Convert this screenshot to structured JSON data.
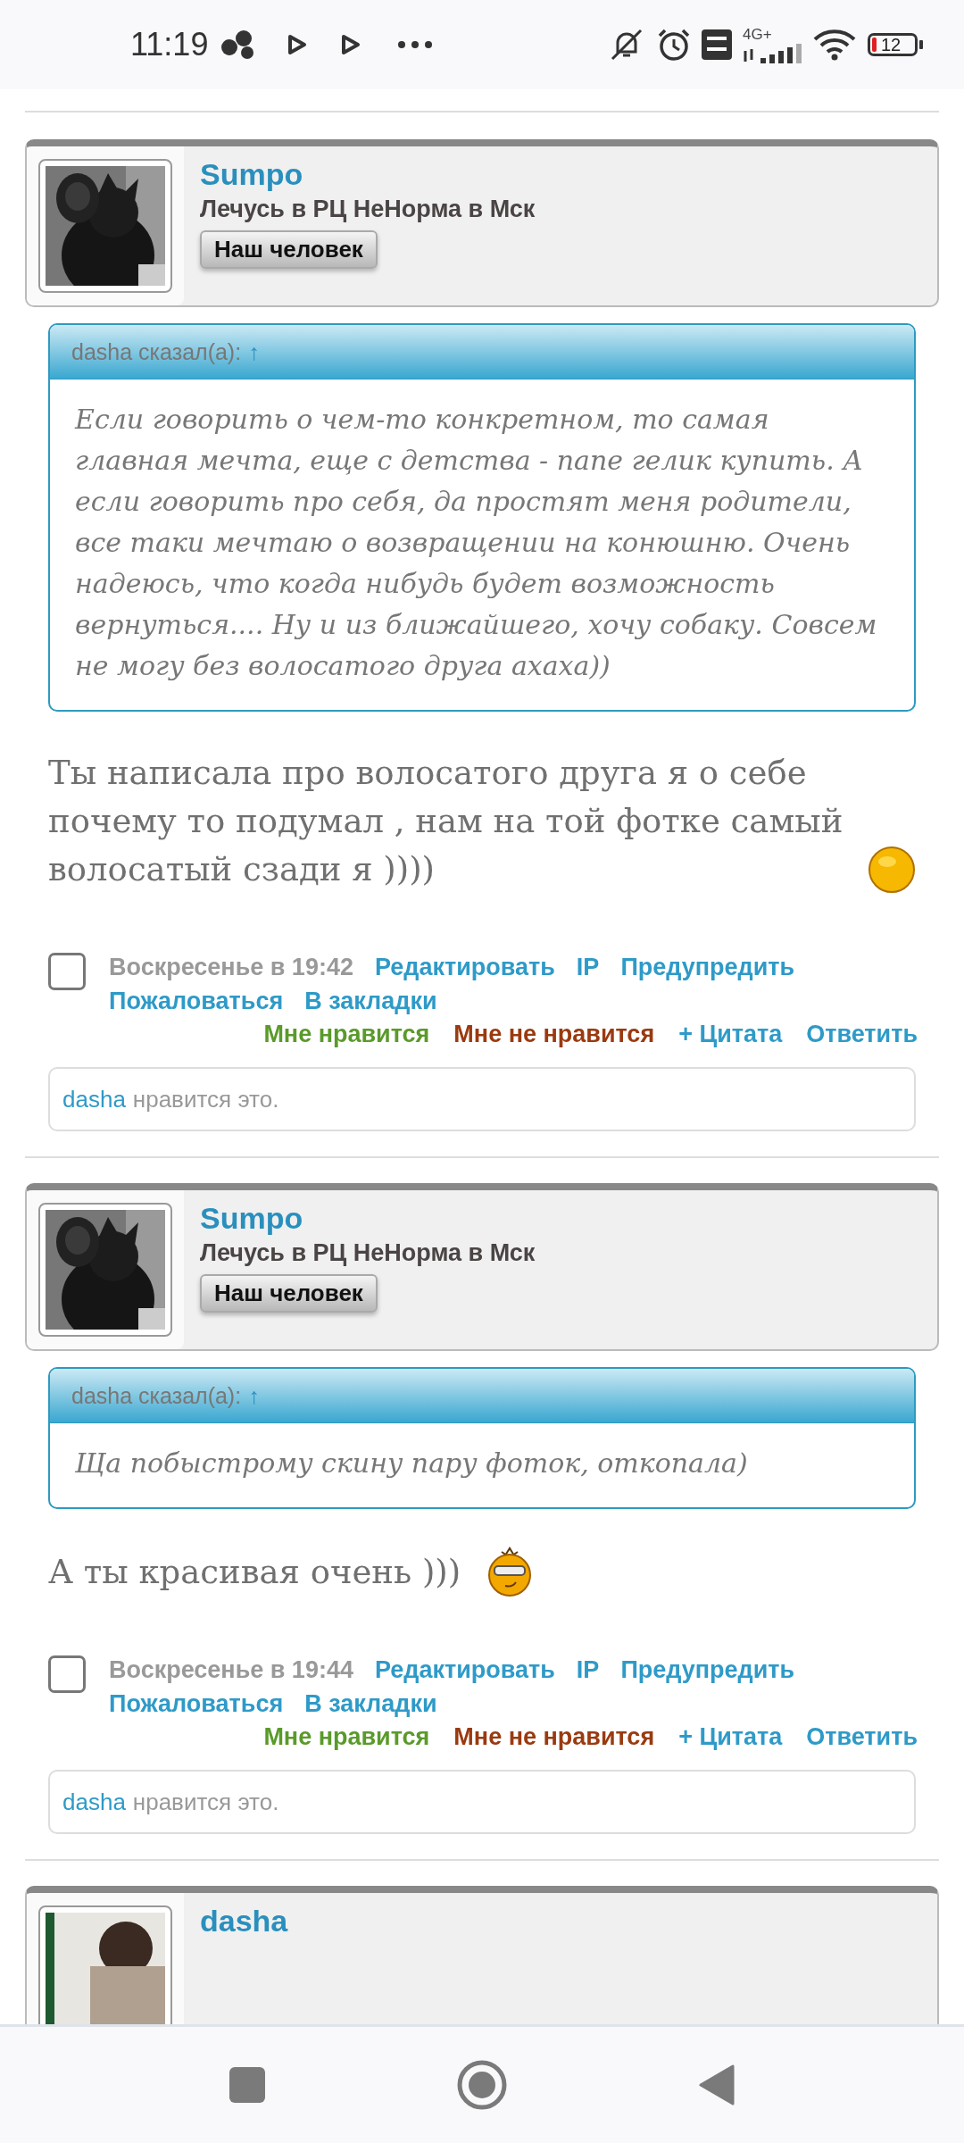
{
  "status_bar": {
    "time": "11:19",
    "network": "4G+",
    "battery": "12"
  },
  "posts": [
    {
      "author": "Sumpo",
      "avatar": {
        "kind": "picture"
      },
      "status": "Лечусь в РЦ НеНорма в Мск",
      "rank": "Наш человек",
      "quote": {
        "author": "dasha",
        "said": "сказал(а):",
        "arrow": "↑",
        "text": "Если говорить о чем-то конкретном, то самая главная мечта, еще с детства - папе гелик купить. А если говорить про себя, да простят меня родители, все таки мечтаю о возвращении на конюшню. Очень надеюсь, что когда нибудь будет возможность вернуться.... Ну и из ближайшего, хочу собаку. Совсем не могу без волосатого друга ахаха))"
      },
      "message": "Ты написала про волосатого друга я о себе почему то подумал , нам на той фотке самый волосатый сзади я ))))",
      "emoji": {
        "kind": "smile"
      },
      "checked": false,
      "date": "Воскресенье в 19:42",
      "actions": [
        "Редактировать",
        "IP",
        "Предупредить",
        "Пожаловаться",
        "В закладки"
      ],
      "reactions": [
        {
          "label": "Мне нравится",
          "kind": "like"
        },
        {
          "label": "Мне не нравится",
          "kind": "dislike"
        },
        {
          "label": "+ Цитата",
          "kind": "link"
        },
        {
          "label": "Ответить",
          "kind": "link"
        }
      ],
      "likes": {
        "user": "dasha",
        "text": "нравится это."
      }
    },
    {
      "author": "Sumpo",
      "avatar": {
        "kind": "picture"
      },
      "status": "Лечусь в РЦ НеНорма в Мск",
      "rank": "Наш человек",
      "quote": {
        "author": "dasha",
        "said": "сказал(а):",
        "arrow": "↑",
        "text": "Ща побыстрому скину пару фоток, откопала)"
      },
      "message": "А ты красивая очень )))",
      "emoji": {
        "kind": "cool"
      },
      "checked": false,
      "date": "Воскресенье в 19:44",
      "actions": [
        "Редактировать",
        "IP",
        "Предупредить",
        "Пожаловаться",
        "В закладки"
      ],
      "reactions": [
        {
          "label": "Мне нравится",
          "kind": "like"
        },
        {
          "label": "Мне не нравится",
          "kind": "dislike"
        },
        {
          "label": "+ Цитата",
          "kind": "link"
        },
        {
          "label": "Ответить",
          "kind": "link"
        }
      ],
      "likes": {
        "user": "dasha",
        "text": "нравится это."
      }
    },
    {
      "author": "dasha",
      "avatar": {
        "kind": "picture"
      }
    }
  ]
}
